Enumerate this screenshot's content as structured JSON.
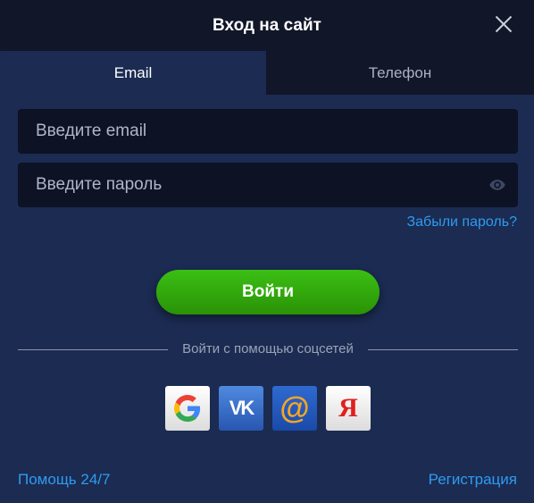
{
  "header": {
    "title": "Вход на сайт"
  },
  "tabs": [
    {
      "label": "Email",
      "active": true
    },
    {
      "label": "Телефон",
      "active": false
    }
  ],
  "form": {
    "email_placeholder": "Введите email",
    "email_value": "",
    "password_placeholder": "Введите пароль",
    "password_value": "",
    "forgot_label": "Забыли пароль?",
    "submit_label": "Войти"
  },
  "social": {
    "divider_label": "Войти с помощью соцсетей",
    "providers": [
      {
        "name": "google",
        "icon": "google-icon"
      },
      {
        "name": "vk",
        "icon": "vk-icon",
        "text": "VK"
      },
      {
        "name": "mail",
        "icon": "mail-ru-icon",
        "text": "@"
      },
      {
        "name": "yandex",
        "icon": "yandex-icon",
        "text": "Я"
      }
    ]
  },
  "footer": {
    "help_label": "Помощь 24/7",
    "register_label": "Регистрация"
  },
  "colors": {
    "background": "#1b2b52",
    "header": "#111628",
    "link": "#2f9bf0",
    "button_green": "#34b10f",
    "input_bg": "#0d1224"
  }
}
